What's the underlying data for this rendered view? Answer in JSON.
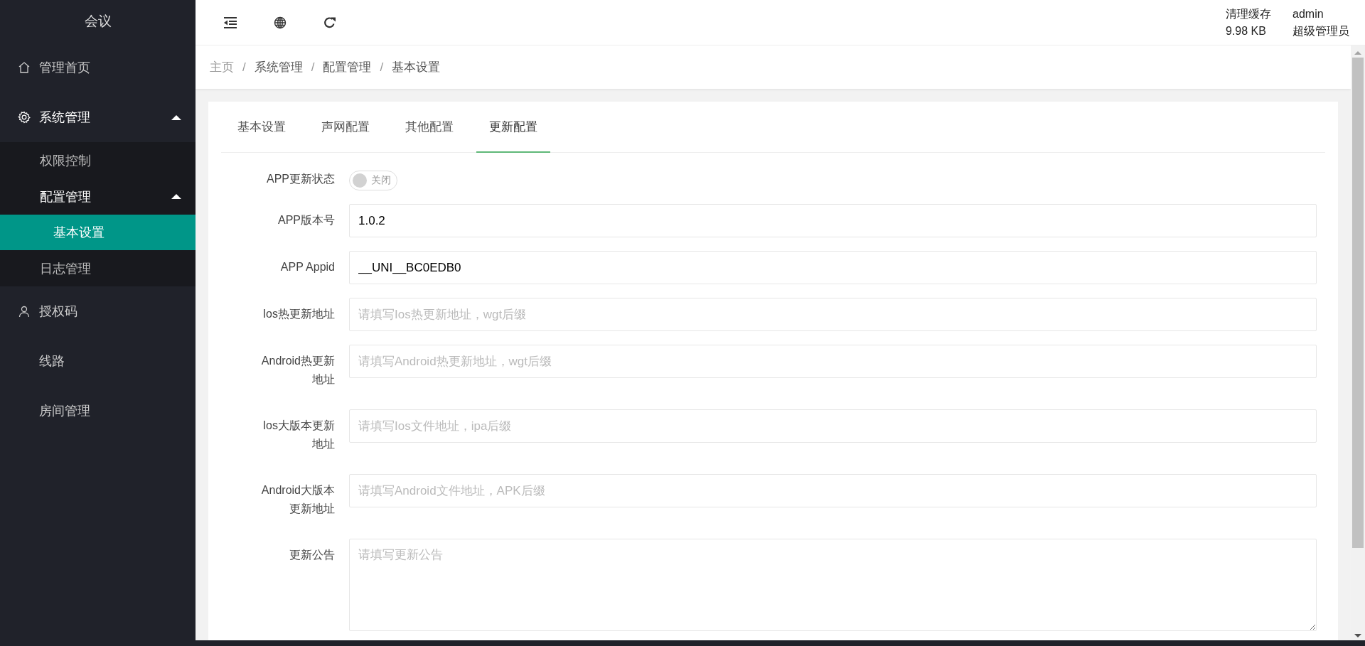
{
  "sidebar": {
    "title": "会议",
    "items": [
      {
        "label": "管理首页",
        "expanded": false
      },
      {
        "label": "系统管理",
        "expanded": true,
        "children": [
          {
            "label": "权限控制",
            "expanded": false,
            "selected": false
          },
          {
            "label": "配置管理",
            "expanded": true,
            "selected": false,
            "children": [
              {
                "label": "基本设置",
                "selected": true
              }
            ]
          },
          {
            "label": "日志管理",
            "selected": false
          }
        ]
      },
      {
        "label": "授权码",
        "expanded": false
      },
      {
        "label": "线路",
        "expanded": false
      },
      {
        "label": "房间管理",
        "expanded": false
      }
    ]
  },
  "header": {
    "cache_label": "清理缓存",
    "cache_size": "9.98 KB",
    "user": "admin",
    "role": "超级管理员"
  },
  "breadcrumb": [
    {
      "kind": "link",
      "text": "主页"
    },
    {
      "kind": "separator",
      "text": "/"
    },
    {
      "kind": "link",
      "text": "系统管理"
    },
    {
      "kind": "separator",
      "text": "/"
    },
    {
      "kind": "link",
      "text": "配置管理"
    },
    {
      "kind": "separator",
      "text": "/"
    },
    {
      "kind": "link",
      "text": "基本设置"
    }
  ],
  "tabs": [
    {
      "label": "基本设置",
      "selected": false
    },
    {
      "label": "声网配置",
      "selected": false
    },
    {
      "label": "其他配置",
      "selected": false
    },
    {
      "label": "更新配置",
      "selected": true
    }
  ],
  "form": [
    {
      "kind": "switch",
      "label": "APP更新状态",
      "on": false,
      "text": "关闭"
    },
    {
      "kind": "input",
      "label": "APP版本号",
      "value": "1.0.2"
    },
    {
      "kind": "input",
      "label": "APP Appid",
      "value": "__UNI__BC0EDB0"
    },
    {
      "kind": "input",
      "label": "Ios热更新地址",
      "placeholder": "请填写Ios热更新地址，wgt后缀"
    },
    {
      "kind": "input",
      "label": "Android热更新地址",
      "placeholder": "请填写Android热更新地址，wgt后缀"
    },
    {
      "kind": "input",
      "label": "Ios大版本更新地址",
      "placeholder": "请填写Ios文件地址，ipa后缀"
    },
    {
      "kind": "input",
      "label": "Android大版本更新地址",
      "placeholder": "请填写Android文件地址，APK后缀"
    },
    {
      "kind": "textarea",
      "label": "更新公告",
      "placeholder": "请填写更新公告"
    }
  ]
}
